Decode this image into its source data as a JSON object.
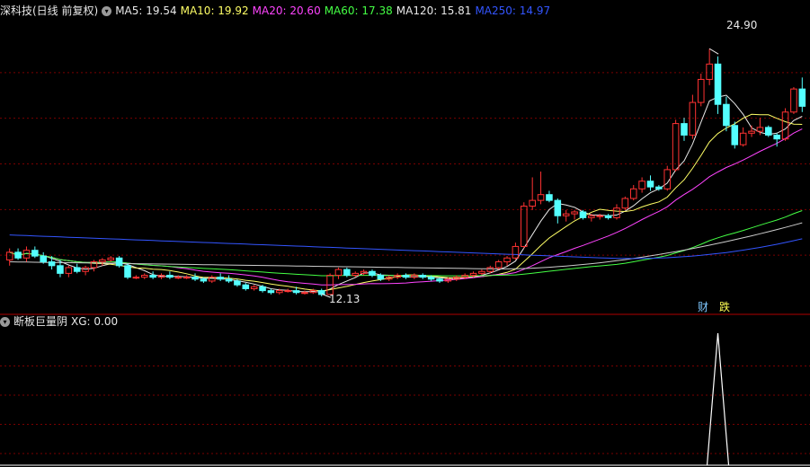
{
  "header": {
    "stock_label": "深科技(日线 前复权)",
    "ma_items": [
      {
        "text": "MA5: 19.54",
        "color": "#e8e8e8"
      },
      {
        "text": "MA10: 19.92",
        "color": "#ffff66"
      },
      {
        "text": "MA20: 20.60",
        "color": "#ff44ff"
      },
      {
        "text": "MA60: 17.38",
        "color": "#44ff44"
      },
      {
        "text": "MA120: 15.81",
        "color": "#e8e8e8"
      },
      {
        "text": "MA250: 14.97",
        "color": "#3355ff"
      }
    ]
  },
  "indicator": {
    "name": "断板巨量阴",
    "xg_text": "XG: 0.00"
  },
  "badges": {
    "cai": "财",
    "die": "跌"
  },
  "annotations": {
    "high_label": "24.90",
    "low_label": "12.13"
  },
  "colors": {
    "up": "#ff3232",
    "down": "#54ffff",
    "grid": "#7a0000",
    "divider": "#b00000",
    "ma5": "#e8e8e8",
    "ma10": "#ffff66",
    "ma20": "#ff44ff",
    "ma60": "#44ff44",
    "ma120": "#cccccc",
    "ma250": "#3355ff"
  },
  "chart_data": {
    "type": "candlestick",
    "price_range": [
      11.3,
      26.5
    ],
    "high": 24.9,
    "low": 12.13,
    "candles": [
      [
        13.9,
        14.5,
        13.6,
        14.3
      ],
      [
        14.3,
        14.5,
        13.9,
        14.0
      ],
      [
        14.0,
        14.6,
        13.8,
        14.4
      ],
      [
        14.4,
        14.6,
        14.0,
        14.1
      ],
      [
        14.1,
        14.3,
        13.7,
        13.8
      ],
      [
        13.8,
        14.1,
        13.4,
        13.6
      ],
      [
        13.6,
        13.9,
        13.0,
        13.2
      ],
      [
        13.2,
        13.6,
        13.0,
        13.5
      ],
      [
        13.5,
        13.7,
        13.2,
        13.3
      ],
      [
        13.3,
        13.6,
        13.1,
        13.5
      ],
      [
        13.5,
        13.9,
        13.3,
        13.8
      ],
      [
        13.8,
        14.0,
        13.6,
        13.9
      ],
      [
        13.9,
        14.1,
        13.8,
        14.0
      ],
      [
        14.0,
        14.1,
        13.5,
        13.6
      ],
      [
        13.6,
        13.7,
        12.9,
        13.0
      ],
      [
        13.0,
        13.1,
        12.9,
        13.0
      ],
      [
        13.0,
        13.2,
        12.9,
        13.1
      ],
      [
        13.1,
        13.3,
        12.9,
        13.0
      ],
      [
        13.0,
        13.2,
        12.9,
        13.1
      ],
      [
        13.1,
        13.3,
        12.9,
        13.0
      ],
      [
        13.0,
        13.1,
        12.9,
        13.0
      ],
      [
        13.0,
        13.1,
        12.9,
        13.0
      ],
      [
        13.0,
        13.2,
        12.8,
        12.9
      ],
      [
        12.9,
        13.0,
        12.7,
        12.8
      ],
      [
        12.8,
        13.1,
        12.7,
        13.0
      ],
      [
        13.0,
        13.2,
        12.8,
        12.9
      ],
      [
        12.9,
        13.1,
        12.7,
        12.8
      ],
      [
        12.8,
        12.9,
        12.5,
        12.6
      ],
      [
        12.6,
        12.7,
        12.3,
        12.4
      ],
      [
        12.4,
        12.6,
        12.3,
        12.5
      ],
      [
        12.5,
        12.6,
        12.2,
        12.3
      ],
      [
        12.3,
        12.4,
        12.1,
        12.2
      ],
      [
        12.2,
        12.4,
        12.1,
        12.3
      ],
      [
        12.3,
        12.4,
        12.2,
        12.3
      ],
      [
        12.3,
        12.5,
        12.1,
        12.2
      ],
      [
        12.2,
        12.3,
        12.1,
        12.2
      ],
      [
        12.2,
        12.4,
        12.13,
        12.3
      ],
      [
        12.3,
        12.4,
        12.0,
        12.1
      ],
      [
        12.1,
        13.2,
        12.1,
        13.1
      ],
      [
        13.1,
        13.5,
        12.9,
        13.4
      ],
      [
        13.4,
        13.5,
        13.0,
        13.1
      ],
      [
        13.1,
        13.3,
        13.0,
        13.2
      ],
      [
        13.2,
        13.4,
        13.1,
        13.3
      ],
      [
        13.3,
        13.4,
        13.0,
        13.1
      ],
      [
        13.1,
        13.2,
        12.8,
        12.9
      ],
      [
        12.9,
        13.1,
        12.8,
        13.0
      ],
      [
        13.0,
        13.2,
        12.9,
        13.1
      ],
      [
        13.1,
        13.2,
        12.9,
        13.0
      ],
      [
        13.0,
        13.2,
        12.9,
        13.1
      ],
      [
        13.1,
        13.2,
        12.9,
        13.0
      ],
      [
        13.0,
        13.1,
        12.8,
        12.9
      ],
      [
        12.9,
        13.0,
        12.7,
        12.8
      ],
      [
        12.8,
        13.0,
        12.7,
        12.9
      ],
      [
        12.9,
        13.1,
        12.8,
        13.0
      ],
      [
        13.0,
        13.2,
        12.9,
        13.1
      ],
      [
        13.1,
        13.3,
        13.0,
        13.2
      ],
      [
        13.2,
        13.4,
        13.1,
        13.3
      ],
      [
        13.3,
        13.6,
        13.2,
        13.5
      ],
      [
        13.5,
        13.9,
        13.4,
        13.8
      ],
      [
        13.8,
        14.1,
        13.6,
        14.0
      ],
      [
        14.0,
        14.8,
        13.9,
        14.6
      ],
      [
        14.6,
        16.9,
        14.5,
        16.7
      ],
      [
        16.7,
        18.2,
        16.5,
        17.0
      ],
      [
        17.0,
        18.5,
        16.8,
        17.3
      ],
      [
        17.3,
        17.5,
        16.9,
        17.0
      ],
      [
        17.0,
        17.1,
        15.8,
        16.2
      ],
      [
        16.2,
        16.5,
        15.9,
        16.3
      ],
      [
        16.3,
        16.5,
        16.0,
        16.4
      ],
      [
        16.4,
        16.5,
        16.0,
        16.1
      ],
      [
        16.1,
        16.3,
        15.9,
        16.2
      ],
      [
        16.2,
        16.3,
        16.0,
        16.2
      ],
      [
        16.2,
        16.3,
        16.0,
        16.1
      ],
      [
        16.1,
        16.8,
        16.0,
        16.6
      ],
      [
        16.6,
        17.2,
        16.5,
        17.1
      ],
      [
        17.1,
        17.8,
        17.0,
        17.6
      ],
      [
        17.6,
        18.2,
        17.4,
        18.0
      ],
      [
        18.0,
        18.3,
        17.5,
        17.7
      ],
      [
        17.7,
        17.8,
        17.5,
        17.6
      ],
      [
        17.6,
        18.8,
        17.5,
        18.6
      ],
      [
        18.6,
        21.2,
        18.5,
        21.0
      ],
      [
        21.0,
        21.3,
        20.1,
        20.4
      ],
      [
        20.4,
        22.5,
        20.2,
        22.1
      ],
      [
        22.1,
        23.6,
        21.9,
        23.3
      ],
      [
        23.3,
        24.9,
        23.0,
        24.1
      ],
      [
        24.1,
        24.5,
        21.5,
        22.0
      ],
      [
        22.0,
        22.4,
        20.6,
        20.9
      ],
      [
        20.9,
        21.1,
        19.7,
        19.9
      ],
      [
        19.9,
        20.8,
        19.8,
        20.5
      ],
      [
        20.5,
        20.9,
        20.3,
        20.6
      ],
      [
        20.6,
        21.3,
        20.4,
        20.8
      ],
      [
        20.8,
        20.9,
        20.3,
        20.4
      ],
      [
        20.4,
        20.5,
        19.8,
        20.2
      ],
      [
        20.2,
        21.8,
        20.1,
        21.6
      ],
      [
        21.6,
        22.9,
        21.5,
        22.8
      ],
      [
        22.8,
        23.4,
        21.6,
        21.9
      ]
    ],
    "indicator_xg": {
      "spike_index": 84,
      "spike_value": 1,
      "baseline": 0
    }
  }
}
